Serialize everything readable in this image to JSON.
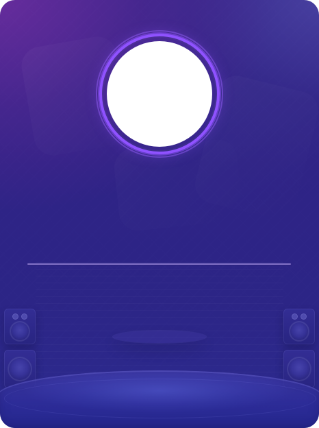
{
  "card": {
    "has_avatar": true
  },
  "theme": {
    "accent": "#8f52ff",
    "background_top": "#4c2aa1",
    "background_mid": "#2f2386",
    "background_bottom": "#2b2a8f",
    "divider": "#a08cdc"
  }
}
